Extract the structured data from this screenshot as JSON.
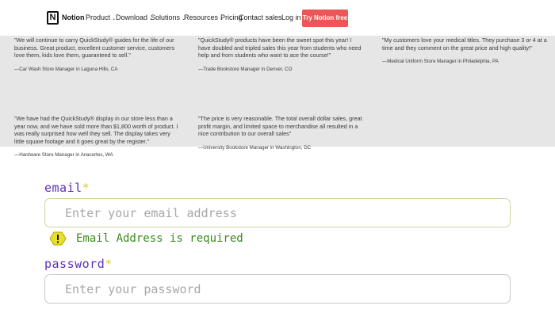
{
  "nav": {
    "brand": "Notion",
    "items": [
      {
        "label": "Product",
        "chevron": true
      },
      {
        "label": "Download",
        "chevron": true
      },
      {
        "label": "Solutions",
        "chevron": true
      },
      {
        "label": "Resources",
        "chevron": true
      },
      {
        "label": "Pricing",
        "chevron": false
      },
      {
        "label": "Contact sales",
        "chevron": false
      },
      {
        "label": "Log in",
        "chevron": false
      }
    ],
    "cta": "Try Notion free"
  },
  "testimonials": [
    {
      "text": "\"We will continue to carry QuickStudy® guides for the life of our business. Great product, excellent customer service, customers love them, kids love them, guaranteed to sell.\"",
      "attribution": "—Car Wash Store Manager in Laguna Hills, CA"
    },
    {
      "text": "\"QuickStudy® products have been the sweet spot this year! I have doubled and tripled sales this year from students who need help and from students who want to ace the course!\"",
      "attribution": "—Trade Bookstore Manager in Denver, CO"
    },
    {
      "text": "\"My customers love your medical titles. They purchase 3 or 4 at a time and they comment on the great price and high quality!\"",
      "attribution": "—Medical Uniform Store Manager in Philadelphia, PA"
    },
    {
      "text": "\"We have had the QuickStudy® display in our store less than a year now, and we have sold more than $1,800 worth of product. I was really surprised how well they sell. The display takes very little square footage and it goes great by the register.\"",
      "attribution": "—Hardware Store Manager in Anacortes, WA"
    },
    {
      "text": "\"The price is very reasonable. The total overall dollar sales, great profit margin, and limited space to merchandise all resulted in a nice contribution to our overall sales\"",
      "attribution": "—University Bookstore Manager in Washington, DC"
    }
  ],
  "form": {
    "email": {
      "label": "email",
      "required_mark": "*",
      "placeholder": "Enter your email address",
      "value": ""
    },
    "email_error": "Email Address is required",
    "password": {
      "label": "password",
      "required_mark": "*",
      "placeholder": "Enter your password",
      "value": ""
    }
  },
  "colors": {
    "label": "#5b2fb8",
    "required": "#d7cc3c",
    "error_text": "#3a8a1e",
    "error_icon": "#e8e02a",
    "cta": "#eb5757"
  }
}
